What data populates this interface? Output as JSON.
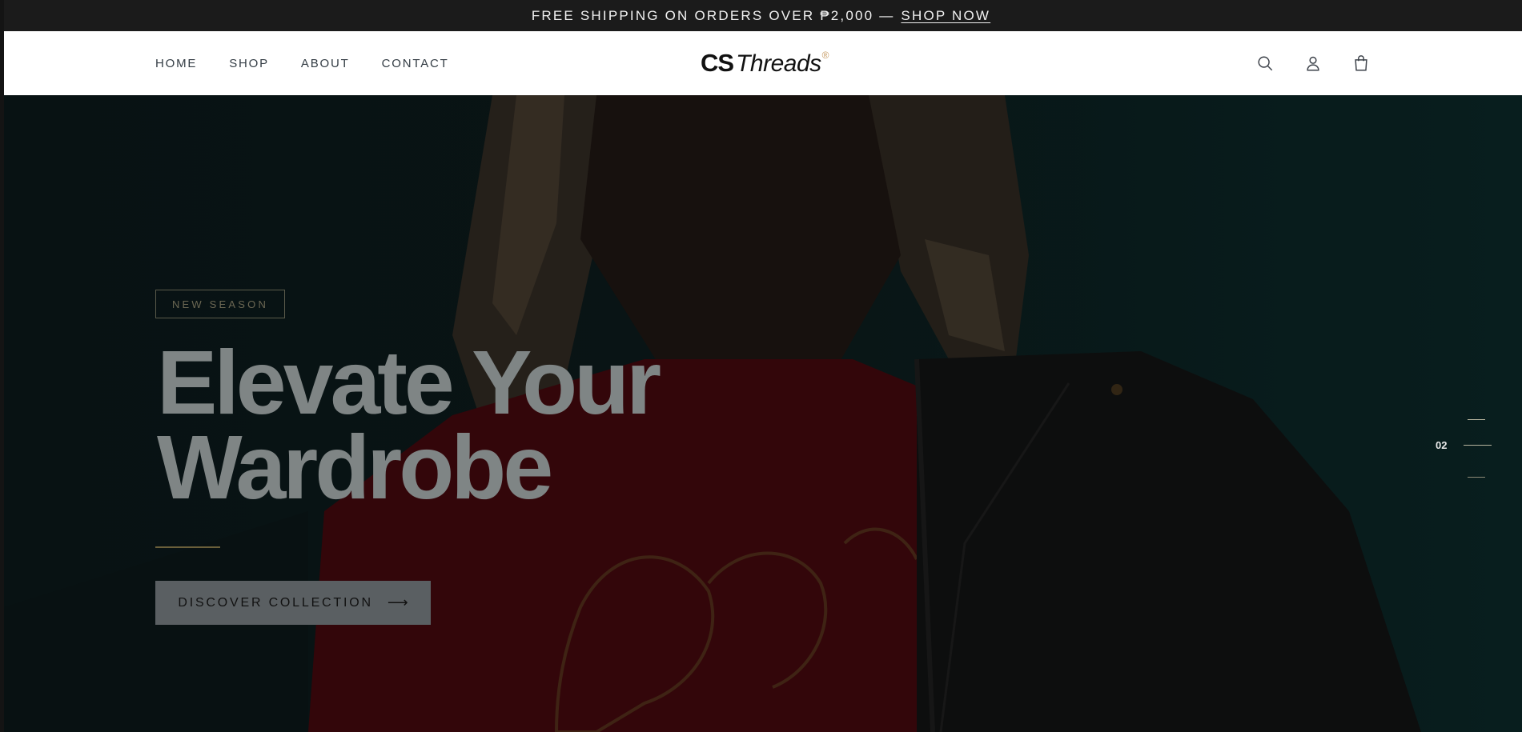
{
  "announcement": {
    "text": "FREE SHIPPING ON ORDERS OVER ₱2,000 —",
    "link": "SHOP NOW"
  },
  "header": {
    "nav": [
      "HOME",
      "SHOP",
      "ABOUT",
      "CONTACT"
    ],
    "logo": {
      "cs": "CS",
      "threads": "Threads",
      "reg": "®"
    },
    "icons": [
      "search-icon",
      "account-icon",
      "cart-icon"
    ]
  },
  "hero": {
    "badge": "NEW SEASON",
    "headline_line1": "Elevate Your",
    "headline_line2": "Wardrobe",
    "cta_label": "DISCOVER COLLECTION",
    "cta_arrow": "⟶",
    "slide_number": "02"
  },
  "colors": {
    "announcement_bg": "#1b1b1b",
    "header_bg": "#ffffff",
    "accent_gold": "#c69a61",
    "hero_text": "#7f8585",
    "cta_bg": "#5a5f62"
  }
}
